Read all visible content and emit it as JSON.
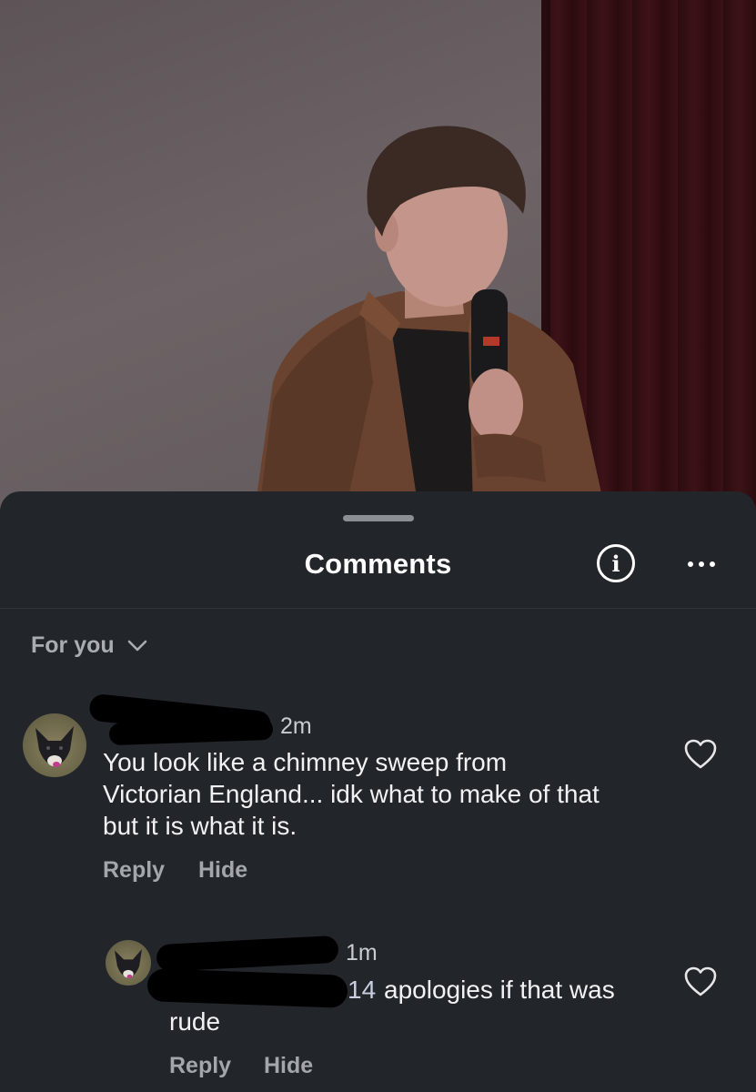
{
  "sheet": {
    "title": "Comments",
    "info_icon": "info-icon",
    "more_icon": "more-icon",
    "filter_label": "For you"
  },
  "comments": [
    {
      "time": "2m",
      "text": "You look like a chimney sweep from Victorian England... idk what to make of that but it is what it is.",
      "reply_label": "Reply",
      "hide_label": "Hide",
      "avatar_icon": "dog-avatar",
      "like_icon": "heart-icon"
    },
    {
      "time": "1m",
      "mention_tail": "14",
      "text": "apologies if that was",
      "text_cont": "rude",
      "reply_label": "Reply",
      "hide_label": "Hide",
      "avatar_icon": "dog-avatar",
      "like_icon": "heart-icon"
    }
  ],
  "colors": {
    "sheet_bg": "#222529",
    "text_primary": "#f1f2f4",
    "text_secondary": "#a3a6ab"
  }
}
